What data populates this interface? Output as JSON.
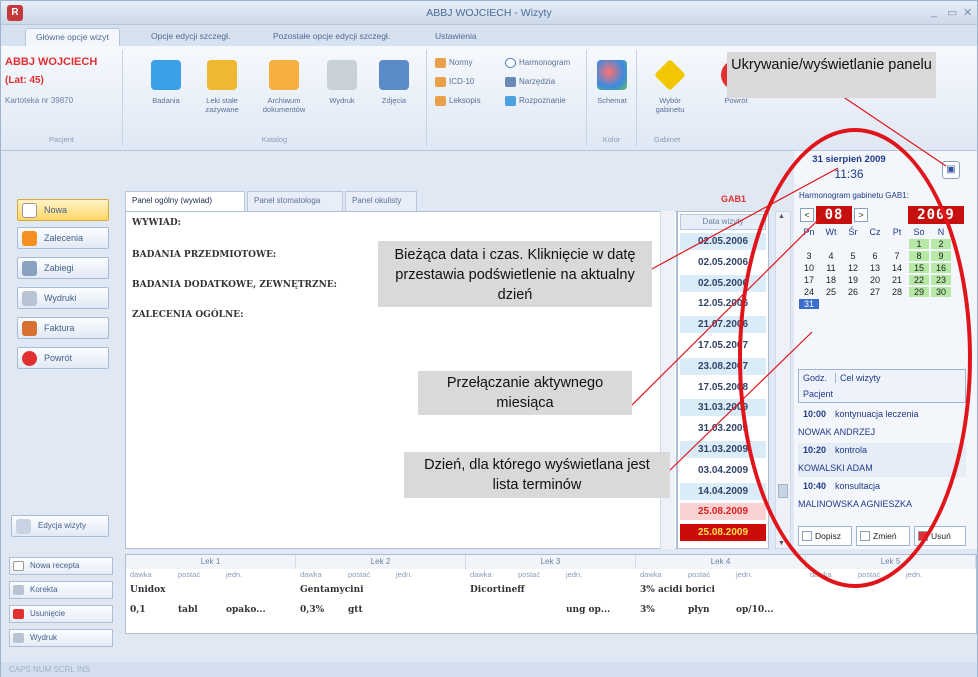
{
  "titlebar": {
    "title": "ABBJ WOJCIECH - Wizyty",
    "min": "_",
    "max": "▭",
    "close": "✕",
    "app_icon": "R"
  },
  "tabs": [
    "Główne opcje wizyt",
    "Opcje edycji szczegł.",
    "Pozostałe opcje edycji szczegł.",
    "Ustawienia"
  ],
  "patient": {
    "name": "ABBJ WOJCIECH",
    "age": "(Lat: 45)",
    "card": "Kartoteka nr 39870",
    "group": "Pacjent"
  },
  "ribbon": {
    "katalog": [
      {
        "label": "Badania",
        "color": "#3aa0e8"
      },
      {
        "label": "Leki stałe zażywane",
        "color": "#f0b830"
      },
      {
        "label": "Archiwum dokumentów",
        "color": "#f5b040"
      },
      {
        "label": "Wydruk",
        "color": "#c8d0d8"
      },
      {
        "label": "Zdjęcia",
        "color": "#5a8ac8"
      }
    ],
    "small": [
      "Normy",
      "ICD-10",
      "Leksopis",
      "Harmonogram",
      "Narzędzia",
      "Rozpoznanie"
    ],
    "katalog_label": "Katalog",
    "kolor": {
      "btn": "Schemat",
      "label": "Kolor"
    },
    "gabinet": {
      "btn1": "Wybór gabinetu",
      "btn2": "Powrót",
      "label": "Gabinet"
    }
  },
  "leftnav": [
    "Nowa",
    "Zalecenia",
    "Zabiegi",
    "Wydruki",
    "Faktura",
    "Powrót"
  ],
  "edit_visit": "Edycja wizyty",
  "panel_tabs": [
    "Panel ogólny (wywiad)",
    "Panel stomatologa",
    "Panel okulisty"
  ],
  "gab": "GAB1",
  "editor_lines": [
    "WYWIAD:",
    "BADANIA PRZEDMIOTOWE:",
    "BADANIA DODATKOWE, ZEWNĘTRZNE:",
    "ZALECENIA OGÓLNE:"
  ],
  "dates_header": "Data wizyty",
  "dates": [
    "02.05.2006",
    "02.05.2006",
    "02.05.2006",
    "12.05.2006",
    "21.07.2006",
    "17.05.2007",
    "23.08.2007",
    "17.05.2008",
    "31.03.2009",
    "31.03.2009",
    "31.03.2009",
    "03.04.2009",
    "14.04.2009",
    "25.08.2009",
    "25.08.2009"
  ],
  "right": {
    "date": "31 sierpień 2009",
    "time": "11:36",
    "toggle_icon": "panel-toggle-icon",
    "harmonogram": "Harmonogram gabinetu GAB1:",
    "month": "08",
    "year": "2009",
    "prev": "<",
    "next": ">",
    "weekdays": [
      "Pn",
      "Wt",
      "Śr",
      "Cz",
      "Pt",
      "So",
      "N"
    ],
    "days": [
      "1",
      "2",
      "3",
      "4",
      "5",
      "6",
      "7",
      "8",
      "9",
      "10",
      "11",
      "12",
      "13",
      "14",
      "15",
      "16",
      "17",
      "18",
      "19",
      "20",
      "21",
      "22",
      "23",
      "24",
      "25",
      "26",
      "27",
      "28",
      "29",
      "30",
      "31"
    ],
    "sched_cols": [
      "Godz.",
      "Cel wizyty",
      "Pacjent"
    ],
    "appointments": [
      {
        "time": "10:00",
        "desc": "kontynuacja leczenia",
        "patient": "NOWAK ANDRZEJ"
      },
      {
        "time": "10:20",
        "desc": "kontrola",
        "patient": "KOWALSKI ADAM"
      },
      {
        "time": "10:40",
        "desc": "konsultacja",
        "patient": "MALINOWSKA AGNIESZKA"
      }
    ],
    "buttons": [
      "Dopisz",
      "Zmień",
      "Usuń"
    ]
  },
  "bottom_left": [
    "Nowa recepta",
    "Korekta",
    "Usunięcie",
    "Wydruk"
  ],
  "meds": {
    "headers": [
      "Lek 1",
      "Lek 2",
      "Lek 3",
      "Lek 4",
      "Lek 5"
    ],
    "sub": [
      "dawka",
      "postać",
      "jedn."
    ],
    "names": [
      "Unidox",
      "Gentamycini",
      "Dicortineff",
      "3% acidi borici"
    ],
    "rows": [
      [
        "0,1",
        "tabl",
        "opako..."
      ],
      [
        "0,3%",
        "gtt",
        ""
      ],
      [
        "",
        "",
        "ung op..."
      ],
      [
        "3%",
        "płyn",
        "op/10..."
      ]
    ]
  },
  "status": "CAPS  NUM  SCRL  INS",
  "callouts": {
    "c1": "Ukrywanie/wyświetlanie panelu",
    "c2": "Bieżąca data i czas. Kliknięcie w datę przestawia podświetlenie na aktualny dzień",
    "c3": "Przełączanie aktywnego miesiąca",
    "c4": "Dzień, dla którego wyświetlana jest lista terminów"
  },
  "colors": {
    "accent_red": "#e0151b",
    "date_highlight": "#c61010"
  }
}
